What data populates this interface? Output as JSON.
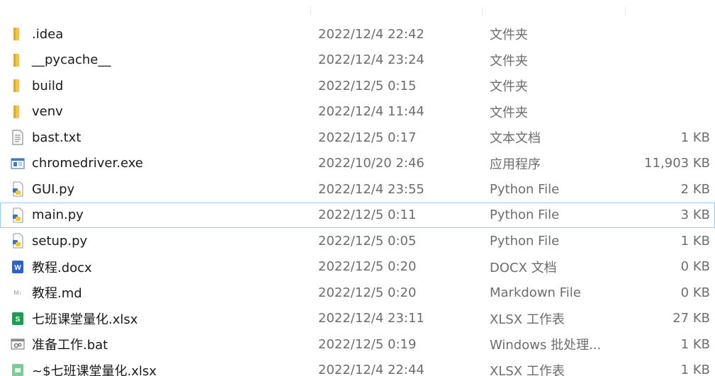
{
  "files": [
    {
      "name": ".idea",
      "date": "2022/12/4 22:42",
      "type": "文件夹",
      "size": "",
      "icon": "folder-icon"
    },
    {
      "name": "__pycache__",
      "date": "2022/12/4 23:24",
      "type": "文件夹",
      "size": "",
      "icon": "folder-icon"
    },
    {
      "name": "build",
      "date": "2022/12/5 0:15",
      "type": "文件夹",
      "size": "",
      "icon": "folder-icon"
    },
    {
      "name": "venv",
      "date": "2022/12/4 11:44",
      "type": "文件夹",
      "size": "",
      "icon": "folder-icon"
    },
    {
      "name": "bast.txt",
      "date": "2022/12/5 0:17",
      "type": "文本文档",
      "size": "1 KB",
      "icon": "text-file-icon"
    },
    {
      "name": "chromedriver.exe",
      "date": "2022/10/20 2:46",
      "type": "应用程序",
      "size": "11,903 KB",
      "icon": "exe-icon"
    },
    {
      "name": "GUI.py",
      "date": "2022/12/4 23:55",
      "type": "Python File",
      "size": "2 KB",
      "icon": "python-file-icon"
    },
    {
      "name": "main.py",
      "date": "2022/12/5 0:11",
      "type": "Python File",
      "size": "3 KB",
      "icon": "python-file-icon"
    },
    {
      "name": "setup.py",
      "date": "2022/12/5 0:05",
      "type": "Python File",
      "size": "1 KB",
      "icon": "python-file-icon"
    },
    {
      "name": "教程.docx",
      "date": "2022/12/5 0:20",
      "type": "DOCX 文档",
      "size": "0 KB",
      "icon": "word-file-icon"
    },
    {
      "name": "教程.md",
      "date": "2022/12/5 0:20",
      "type": "Markdown File",
      "size": "0 KB",
      "icon": "markdown-file-icon"
    },
    {
      "name": "七班课堂量化.xlsx",
      "date": "2022/12/4 23:11",
      "type": "XLSX 工作表",
      "size": "27 KB",
      "icon": "excel-file-icon"
    },
    {
      "name": "准备工作.bat",
      "date": "2022/12/5 0:19",
      "type": "Windows 批处理...",
      "size": "1 KB",
      "icon": "batch-file-icon"
    },
    {
      "name": "~$七班课堂量化.xlsx",
      "date": "2022/12/4 22:44",
      "type": "XLSX 工作表",
      "size": "1 KB",
      "icon": "excel-temp-file-icon"
    }
  ],
  "focused_row": 7,
  "colors": {
    "folder": "#f3c448",
    "focus_border": "#99c9f0",
    "secondary_text": "#6d6d6d"
  }
}
